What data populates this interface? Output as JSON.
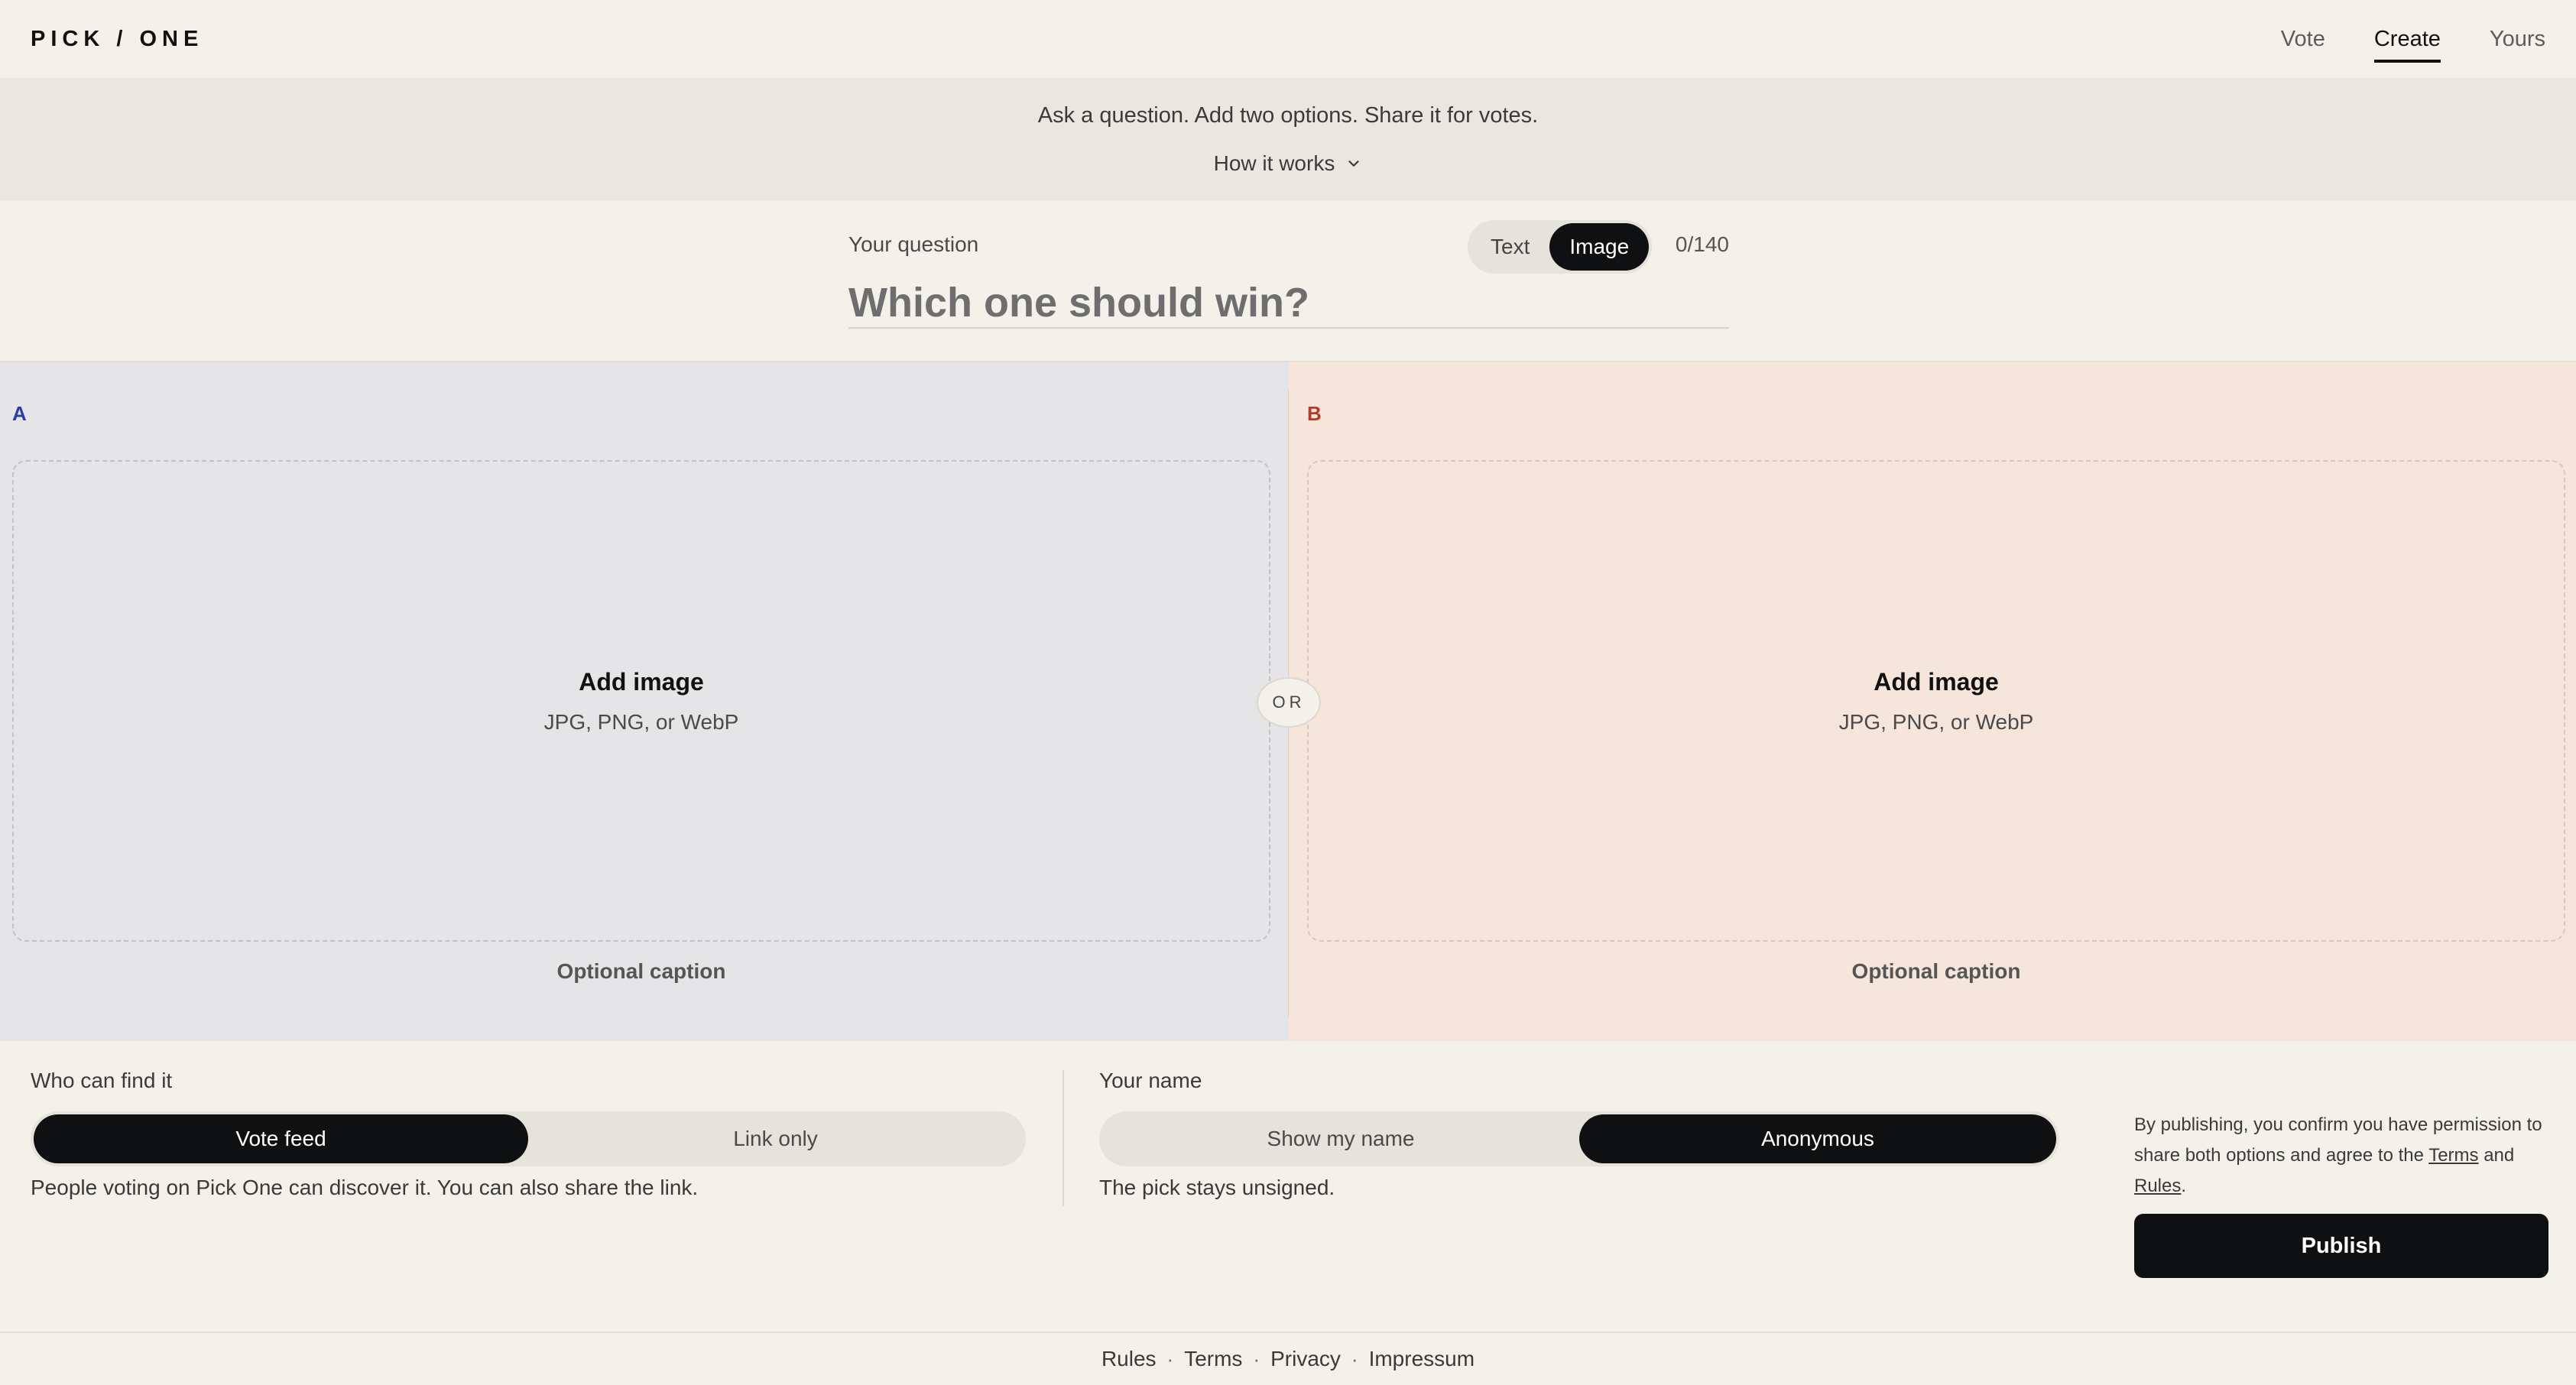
{
  "header": {
    "logo": "PICK / ONE",
    "nav": [
      {
        "label": "Vote",
        "active": false
      },
      {
        "label": "Create",
        "active": true
      },
      {
        "label": "Yours",
        "active": false
      }
    ]
  },
  "banner": {
    "text": "Ask a question. Add two options. Share it for votes.",
    "how_it_works": "How it works",
    "icon": "chevron-down-icon"
  },
  "question": {
    "label": "Your question",
    "mode_options": [
      "Text",
      "Image"
    ],
    "mode_selected": "Image",
    "counter": "0/140",
    "value": "",
    "placeholder": "Which one should win?"
  },
  "options": {
    "a": {
      "letter": "A",
      "dropzone_title": "Add image",
      "dropzone_formats": "JPG, PNG, or WebP",
      "caption_placeholder": "Optional caption"
    },
    "b": {
      "letter": "B",
      "dropzone_title": "Add image",
      "dropzone_formats": "JPG, PNG, or WebP",
      "caption_placeholder": "Optional caption"
    },
    "or_label": "OR"
  },
  "visibility": {
    "label": "Who can find it",
    "options": [
      "Vote feed",
      "Link only"
    ],
    "selected": "Vote feed",
    "help": "People voting on Pick One can discover it. You can also share the link."
  },
  "identity": {
    "label": "Your name",
    "options": [
      "Show my name",
      "Anonymous"
    ],
    "selected": "Anonymous",
    "help": "The pick stays unsigned."
  },
  "publish": {
    "legal_prefix": "By publishing, you confirm you have permission to share both options and agree to the ",
    "terms_link": "Terms",
    "legal_and": " and ",
    "rules_link": "Rules",
    "legal_suffix": ".",
    "button_label": "Publish"
  },
  "footer": {
    "links": [
      "Rules",
      "Terms",
      "Privacy",
      "Impressum"
    ],
    "separator": "·"
  },
  "colors": {
    "background": "#f4f1ea",
    "panel_a": "#e5e4e7",
    "panel_b": "#f6e5db",
    "accent_dark": "#0f1012",
    "letter_a": "#2b3ea8",
    "letter_b": "#b23b2a"
  }
}
